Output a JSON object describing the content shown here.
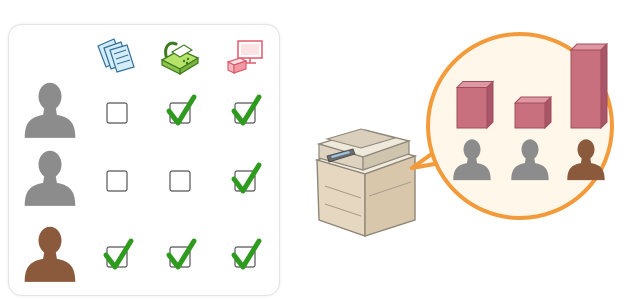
{
  "matrix": {
    "columns": [
      {
        "function": "copy",
        "icon": "copy-documents-icon"
      },
      {
        "function": "fax",
        "icon": "fax-machine-icon"
      },
      {
        "function": "print",
        "icon": "pc-printer-icon"
      }
    ],
    "rows": [
      {
        "user_color": "#8c8c8c",
        "permissions": [
          false,
          true,
          true
        ]
      },
      {
        "user_color": "#8c8c8c",
        "permissions": [
          false,
          false,
          true
        ]
      },
      {
        "user_color": "#8b5a3c",
        "permissions": [
          true,
          true,
          true
        ]
      }
    ],
    "check_color": "#2e9a1e"
  },
  "usage_callout": {
    "border_color": "#f39a3a",
    "fill_color": "#fff7ea",
    "bar_color": "#c8707d",
    "bars": [
      {
        "user": "user-1",
        "level": 0.52,
        "user_color": "#8c8c8c"
      },
      {
        "user": "user-2",
        "level": 0.32,
        "user_color": "#8c8c8c"
      },
      {
        "user": "user-3",
        "level": 1.0,
        "user_color": "#8b5a3c"
      }
    ]
  },
  "device": {
    "icon": "multifunction-printer-icon"
  }
}
